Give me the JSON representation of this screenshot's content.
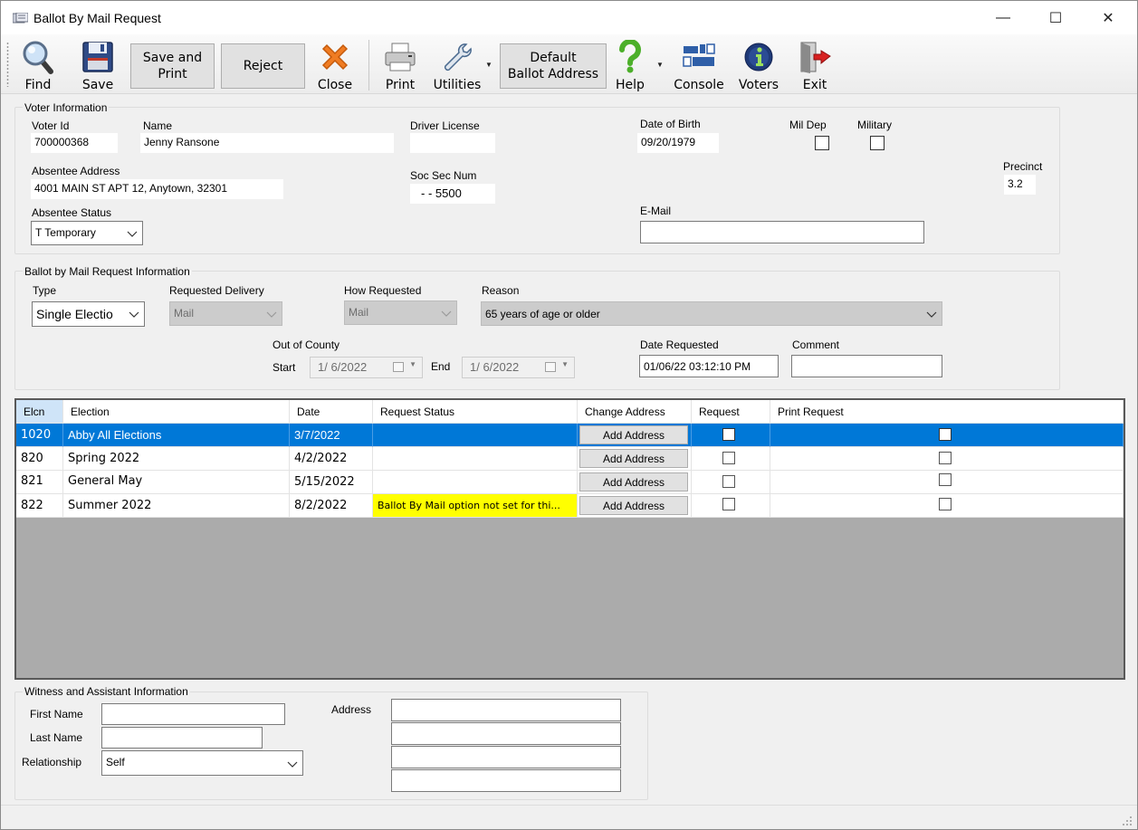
{
  "window": {
    "title": "Ballot By Mail Request",
    "minimize_glyph": "—",
    "maximize_glyph": "☐",
    "close_glyph": "✕"
  },
  "toolbar": {
    "find": "Find",
    "save": "Save",
    "save_and_print_line1": "Save and",
    "save_and_print_line2": "Print",
    "reject": "Reject",
    "close": "Close",
    "print": "Print",
    "utilities": "Utilities",
    "default_ballot_line1": "Default",
    "default_ballot_line2": "Ballot Address",
    "help": "Help",
    "console": "Console",
    "voters": "Voters",
    "exit": "Exit"
  },
  "voter_info": {
    "group_title": "Voter Information",
    "voter_id_label": "Voter Id",
    "voter_id": "700000368",
    "name_label": "Name",
    "name": "Jenny Ransone",
    "driver_license_label": "Driver License",
    "driver_license": "",
    "dob_label": "Date of Birth",
    "dob": "09/20/1979",
    "mil_dep_label": "Mil Dep",
    "military_label": "Military",
    "absentee_address_label": "Absentee Address",
    "absentee_address": "4001 MAIN ST APT 12, Anytown, 32301",
    "soc_sec_label": "Soc Sec Num",
    "soc_sec": "- - 5500",
    "precinct_label": "Precinct",
    "precinct": "3.2",
    "absentee_status_label": "Absentee Status",
    "absentee_status": "T Temporary",
    "email_label": "E-Mail",
    "email": ""
  },
  "request_info": {
    "group_title": "Ballot by Mail Request Information",
    "type_label": "Type",
    "type": "Single Electio",
    "delivery_label": "Requested Delivery",
    "delivery": "Mail",
    "how_label": "How Requested",
    "how": "Mail",
    "reason_label": "Reason",
    "reason": "65 years of age or older",
    "out_of_county_label": "Out of County",
    "start_label": "Start",
    "start": "1/ 6/2022",
    "end_label": "End",
    "end": "1/ 6/2022",
    "date_requested_label": "Date Requested",
    "date_requested": "01/06/22 03:12:10 PM",
    "comment_label": "Comment",
    "comment": ""
  },
  "grid": {
    "headers": [
      "Elcn",
      "Election",
      "Date",
      "Request Status",
      "Change Address",
      "Request",
      "Print Request"
    ],
    "rows": [
      {
        "elcn": "1020",
        "election": "Abby All Elections",
        "date": "3/7/2022",
        "status": "",
        "button": "Add Address",
        "request": false,
        "print": false,
        "selected": true
      },
      {
        "elcn": "820",
        "election": "Spring 2022",
        "date": "4/2/2022",
        "status": "",
        "button": "Add Address",
        "request": false,
        "print": false,
        "selected": false
      },
      {
        "elcn": "821",
        "election": "General May",
        "date": "5/15/2022",
        "status": "",
        "button": "Add Address",
        "request": false,
        "print": false,
        "selected": false
      },
      {
        "elcn": "822",
        "election": "Summer 2022",
        "date": "8/2/2022",
        "status": "Ballot By Mail option not set for thi...",
        "button": "Add Address",
        "request": false,
        "print": false,
        "selected": false
      }
    ]
  },
  "witness": {
    "group_title": "Witness and Assistant Information",
    "first_name_label": "First Name",
    "first_name": "",
    "last_name_label": "Last Name",
    "last_name": "",
    "relationship_label": "Relationship",
    "relationship": "Self",
    "address_label": "Address",
    "address_lines": [
      "",
      "",
      "",
      ""
    ]
  },
  "colors": {
    "selection": "#0078d7",
    "warning": "#ffff00",
    "grid_background": "#ababab"
  }
}
